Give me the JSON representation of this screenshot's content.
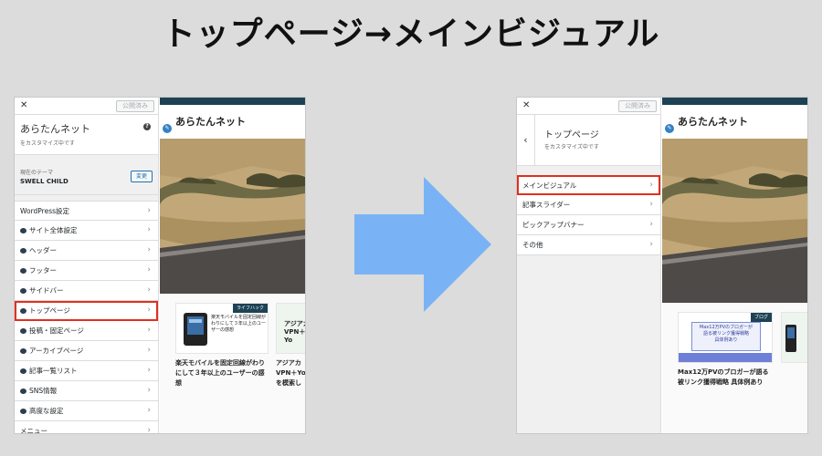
{
  "headline": "トップページ→メインビジュアル",
  "left": {
    "close": "✕",
    "publish": "公開済み",
    "site_title": "あらたんネット",
    "site_sub": "をカスタマイズ中です",
    "help": "?",
    "theme_label": "現在のテーマ",
    "theme_name": "SWELL CHILD",
    "change": "変更",
    "items": [
      {
        "label": "WordPress設定",
        "icon": false
      },
      {
        "label": "サイト全体設定",
        "icon": true
      },
      {
        "label": "ヘッダー",
        "icon": true
      },
      {
        "label": "フッター",
        "icon": true
      },
      {
        "label": "サイドバー",
        "icon": true
      },
      {
        "label": "トップページ",
        "icon": true
      },
      {
        "label": "投稿・固定ページ",
        "icon": true
      },
      {
        "label": "アーカイブページ",
        "icon": true
      },
      {
        "label": "記事一覧リスト",
        "icon": true
      },
      {
        "label": "SNS情報",
        "icon": true
      },
      {
        "label": "高度な設定",
        "icon": true
      },
      {
        "label": "メニュー",
        "icon": false
      }
    ],
    "preview": {
      "site_title": "あらたんネット",
      "card1_tag": "ライフハック",
      "card1_img_text": "楽天モバイルを固定回線がわりにして３年以上のユーザーの感想",
      "card1_title": "楽天モバイルを固定回線がわりにして３年以上のユーザーの感想",
      "card2_img_text": "アジアカ VPN＋Yo",
      "card2_title": "アジアカ VPN＋Yo を模索し"
    }
  },
  "right": {
    "close": "✕",
    "publish": "公開済み",
    "back": "‹",
    "section_title": "トップページ",
    "section_sub": "をカスタマイズ中です",
    "items": [
      {
        "label": "メインビジュアル"
      },
      {
        "label": "記事スライダー"
      },
      {
        "label": "ピックアップバナー"
      },
      {
        "label": "その他"
      }
    ],
    "preview": {
      "site_title": "あらたんネット",
      "card1_tag": "ブログ",
      "card1_img_line1": "Max12万PVのブロガーが",
      "card1_img_line2": "語る被リンク獲得戦略",
      "card1_img_line3": "具体例あり",
      "card1_title": "Max12万PVのブロガーが語る被リンク獲得戦略 具体例あり"
    }
  },
  "colors": {
    "highlight": "#e0301e",
    "arrow": "#7ab3f5",
    "brand_bar": "#1d4254"
  }
}
